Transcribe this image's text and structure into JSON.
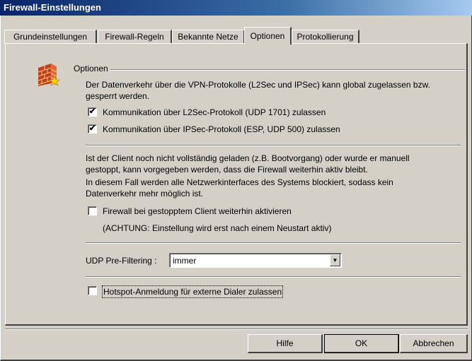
{
  "window": {
    "title": "Firewall-Einstellungen"
  },
  "tabs": [
    {
      "label": "Grundeinstellungen"
    },
    {
      "label": "Firewall-Regeln"
    },
    {
      "label": "Bekannte Netze"
    },
    {
      "label": "Optionen"
    },
    {
      "label": "Protokollierung"
    }
  ],
  "options": {
    "group_label": "Optionen",
    "vpn_description": "Der Datenverkehr über die VPN-Protokolle (L2Sec und IPSec) kann global zugelassen bzw. gesperrt werden.",
    "l2sec_label": "Kommunikation über L2Sec-Protokoll (UDP 1701) zulassen",
    "l2sec_checked": true,
    "ipsec_label": "Kommunikation über IPSec-Protokoll (ESP, UDP 500) zulassen",
    "ipsec_checked": true,
    "client_description_1": "Ist der Client noch nicht vollständig geladen (z.B. Bootvorgang) oder wurde er manuell gestoppt, kann vorgegeben werden, dass die Firewall weiterhin aktiv bleibt.",
    "client_description_2": "In diesem Fall werden alle Netzwerkinterfaces des Systems blockiert, sodass kein Datenverkehr mehr möglich ist.",
    "firewall_stopped_label": "Firewall bei gestopptem Client weiterhin aktivieren",
    "firewall_stopped_checked": false,
    "warning": "(ACHTUNG: Einstellung wird erst nach einem Neustart aktiv)",
    "udp_prefiltering_label": "UDP Pre-Filtering :",
    "udp_prefiltering_value": "immer",
    "hotspot_label": "Hotspot-Anmeldung für externe Dialer zulassen",
    "hotspot_checked": false
  },
  "buttons": {
    "help": "Hilfe",
    "ok": "OK",
    "cancel": "Abbrechen"
  },
  "icons": {
    "firewall": "firewall-brick-wall-icon",
    "check": "✔",
    "dropdown": "▼"
  },
  "colors": {
    "title_start": "#0a246a",
    "title_end": "#a6caf0",
    "face": "#d4d0c8"
  }
}
